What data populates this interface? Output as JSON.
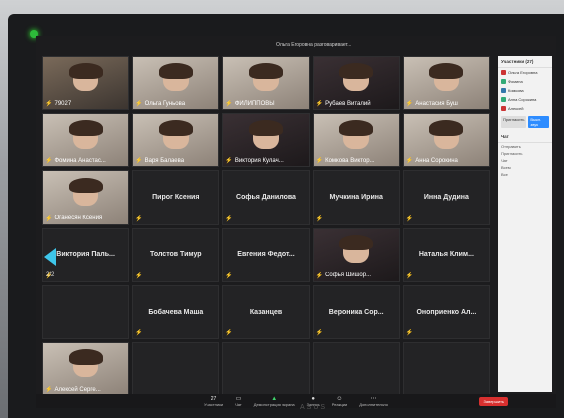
{
  "meeting": {
    "title": "Ольга Егоровна разговаривает..."
  },
  "tiles": [
    {
      "name": "79027",
      "kind": "video",
      "tone": "",
      "muted": true
    },
    {
      "name": "Ольга Гуньова",
      "kind": "video",
      "tone": "light",
      "muted": true
    },
    {
      "name": "ФИЛИППОВЫ",
      "kind": "video",
      "tone": "light",
      "muted": true
    },
    {
      "name": "Рубаев Виталий",
      "kind": "video",
      "tone": "dark",
      "muted": true
    },
    {
      "name": "Анастасия Буш",
      "kind": "video",
      "tone": "light",
      "muted": true
    },
    {
      "name": "Фомина Анастас...",
      "kind": "video",
      "tone": "light",
      "muted": true
    },
    {
      "name": "Варя Балаева",
      "kind": "video",
      "tone": "light",
      "muted": true
    },
    {
      "name": "Виктория Кулач...",
      "kind": "video",
      "tone": "dark",
      "muted": true
    },
    {
      "name": "Комкова Виктор...",
      "kind": "video",
      "tone": "light",
      "muted": true
    },
    {
      "name": "Анна Сорокина",
      "kind": "video",
      "tone": "light",
      "muted": true
    },
    {
      "name": "Оганесян Ксения",
      "kind": "video",
      "tone": "light",
      "muted": true
    },
    {
      "name": "Пирог Ксения",
      "kind": "name",
      "muted": true
    },
    {
      "name": "Софья Данилова",
      "kind": "name",
      "muted": true
    },
    {
      "name": "Мучкина Ирина",
      "kind": "name",
      "muted": true
    },
    {
      "name": "Инна Дудина",
      "kind": "name",
      "muted": true
    },
    {
      "name": "Виктория Паль...",
      "kind": "name",
      "muted": true
    },
    {
      "name": "Толстов Тимур",
      "kind": "name",
      "muted": true
    },
    {
      "name": "Евгения Федот...",
      "kind": "name",
      "muted": true
    },
    {
      "name": "Софья Шишор...",
      "kind": "video",
      "tone": "dark",
      "muted": true
    },
    {
      "name": "Наталья Клим...",
      "kind": "name",
      "muted": true
    },
    {
      "name": "",
      "kind": "name",
      "muted": false
    },
    {
      "name": "Бобачева Маша",
      "kind": "name",
      "muted": true
    },
    {
      "name": "Казанцев",
      "kind": "name",
      "muted": true
    },
    {
      "name": "Вероника Сор...",
      "kind": "name",
      "muted": true
    },
    {
      "name": "Оноприенко Ал...",
      "kind": "name",
      "muted": true
    },
    {
      "name": "Алексей Серге...",
      "kind": "video",
      "tone": "light",
      "muted": true
    },
    {
      "name": "",
      "kind": "name",
      "muted": false
    },
    {
      "name": "",
      "kind": "name",
      "muted": false
    },
    {
      "name": "",
      "kind": "name",
      "muted": false
    },
    {
      "name": "",
      "kind": "name",
      "muted": false
    }
  ],
  "pager": {
    "indicator": "2/2"
  },
  "panel": {
    "header": "Участники (27)",
    "items": [
      "Ольга Егоровна",
      "Фомина",
      "Комкова",
      "Анна Сорокина",
      "Алексей"
    ],
    "btn_invite": "Пригласить",
    "btn_mute": "Выкл. звук",
    "chat_header": "Чат",
    "chat_lines": [
      "Отправить",
      "Пригласить",
      "Чат",
      "Всем",
      "Все"
    ]
  },
  "toolbar": {
    "participants_count": "27",
    "participants_label": "Участники",
    "chat_label": "Чат",
    "share_label": "Демонстрация экрана",
    "record_label": "Запись",
    "reactions_label": "Реакции",
    "more_label": "Дополнительно",
    "end_label": "Завершить"
  },
  "brand": "ASUS"
}
